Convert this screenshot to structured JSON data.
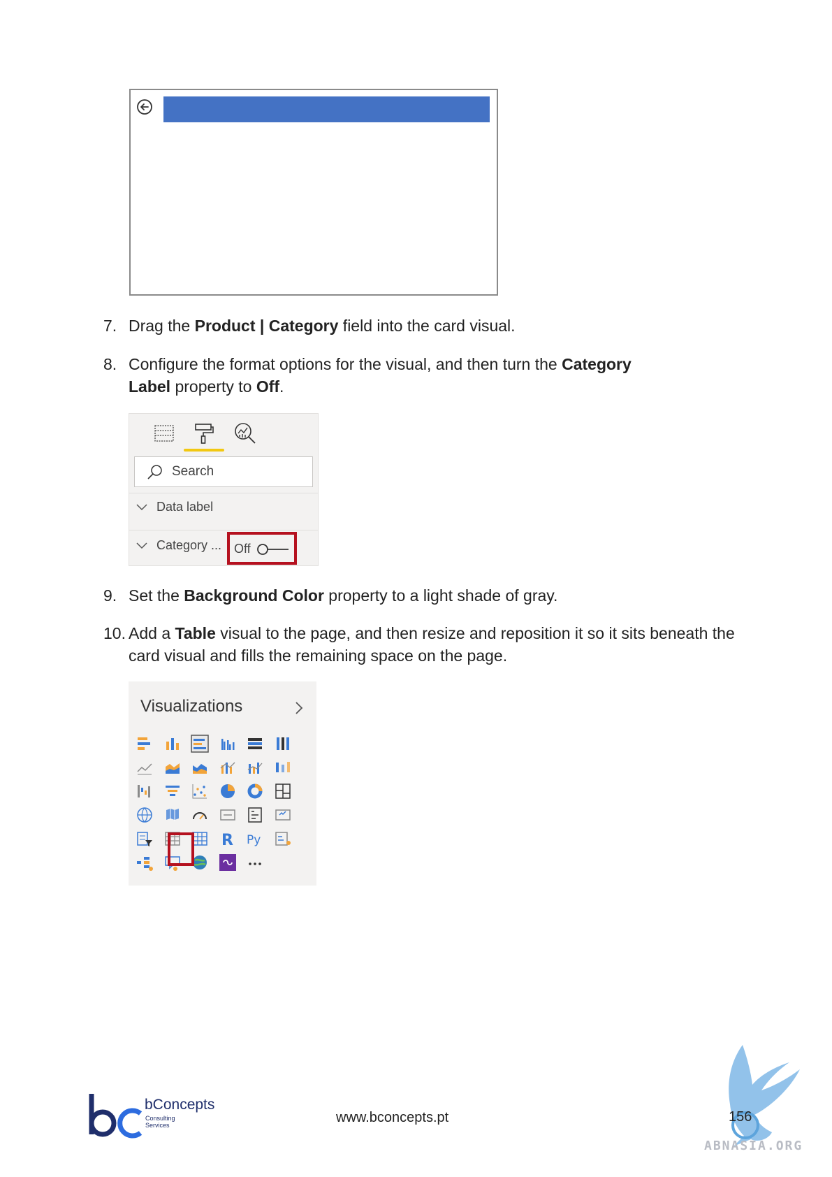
{
  "steps": [
    {
      "number": "7.",
      "parts": [
        "Drag the ",
        "Product | Category",
        " field into the card visual."
      ]
    },
    {
      "number": "8.",
      "line1": [
        "Configure the format options for the visual, and then turn the ",
        "Category"
      ],
      "line2": [
        "Label",
        " property to ",
        "Off",
        "."
      ]
    },
    {
      "number": "9.",
      "parts": [
        "Set the ",
        "Background Color",
        " property to a light shade of gray."
      ]
    },
    {
      "number": "10.",
      "line1": [
        "Add a ",
        "Table",
        " visual to the page, and then resize and reposition it so it sits beneath the"
      ],
      "line2": "card visual and fills the remaining space on the page."
    }
  ],
  "format_pane": {
    "search_placeholder": "Search",
    "rows": [
      {
        "label": "Data label"
      },
      {
        "label": "Category ...",
        "toggle_text": "Off"
      }
    ],
    "colors": {
      "highlight": "#b5111f",
      "active_tab": "#f2c811"
    }
  },
  "card_visual": {
    "colors": {
      "title_bar": "#4472c4"
    }
  },
  "visualizations": {
    "title": "Visualizations",
    "icons": [
      [
        "stacked-bar-icon",
        "stacked-column-icon",
        "clustered-bar-icon",
        "clustered-column-icon",
        "100-stacked-bar-icon",
        "100-stacked-column-icon"
      ],
      [
        "line-chart-icon",
        "area-chart-icon",
        "stacked-area-icon",
        "line-column-icon",
        "line-clustered-column-icon",
        "ribbon-chart-icon"
      ],
      [
        "waterfall-icon",
        "funnel-icon",
        "scatter-icon",
        "pie-icon",
        "donut-icon",
        "treemap-icon"
      ],
      [
        "map-icon",
        "filled-map-icon",
        "gauge-icon",
        "card-icon",
        "multi-row-card-icon",
        "kpi-icon"
      ],
      [
        "slicer-icon",
        "table-icon",
        "matrix-icon",
        "r-visual-icon",
        "python-visual-icon",
        "key-influencers-icon"
      ],
      [
        "decomposition-tree-icon",
        "qa-icon",
        "arcgis-icon",
        "power-apps-icon",
        "more-icon"
      ]
    ]
  },
  "footer": {
    "brand": "bConcepts",
    "brand_sub_1": "Consulting",
    "brand_sub_2": "Services",
    "url": "www.bconcepts.pt",
    "page_number": "156",
    "watermark": "ABNASIA.ORG"
  }
}
